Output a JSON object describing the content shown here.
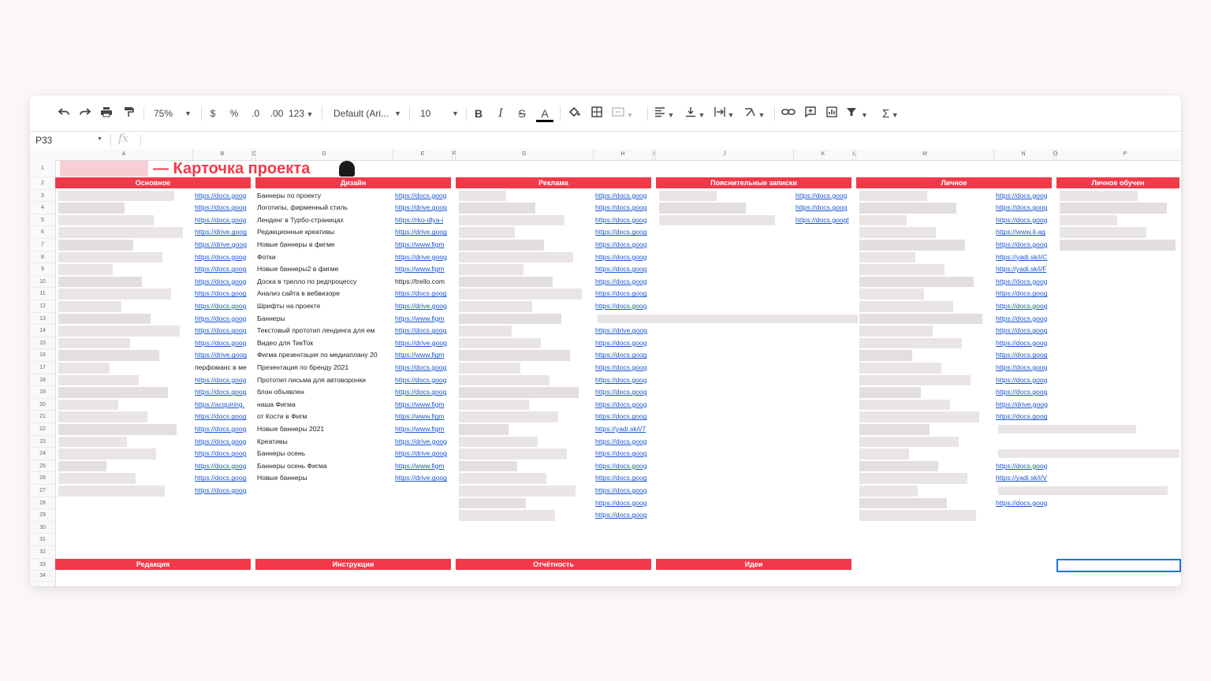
{
  "toolbar": {
    "zoom": "75%",
    "currency": "$",
    "percent": "%",
    "dec_less": ".0",
    "dec_more": ".00",
    "more_formats": "123",
    "font": "Default (Ari...",
    "font_size": "10",
    "bold": "B",
    "italic": "I",
    "strike": "S",
    "text_color": "A",
    "sum": "Σ"
  },
  "formula_bar": {
    "cell_ref": "P33",
    "fx": "fx",
    "value": ""
  },
  "columns": [
    {
      "letter": "A",
      "w": 175
    },
    {
      "letter": "B",
      "w": 75
    },
    {
      "letter": "C",
      "w": 4
    },
    {
      "letter": "D",
      "w": 175
    },
    {
      "letter": "E",
      "w": 75
    },
    {
      "letter": "F",
      "w": 4
    },
    {
      "letter": "G",
      "w": 175
    },
    {
      "letter": "H",
      "w": 75
    },
    {
      "letter": "I",
      "w": 4
    },
    {
      "letter": "J",
      "w": 175
    },
    {
      "letter": "K",
      "w": 75
    },
    {
      "letter": "L",
      "w": 4
    },
    {
      "letter": "M",
      "w": 175
    },
    {
      "letter": "N",
      "w": 75
    },
    {
      "letter": "O",
      "w": 4
    },
    {
      "letter": "P",
      "w": 175
    }
  ],
  "rows": [
    "1",
    "2",
    "3",
    "4",
    "5",
    "6",
    "7",
    "8",
    "9",
    "10",
    "11",
    "12",
    "13",
    "14",
    "15",
    "16",
    "17",
    "18",
    "19",
    "20",
    "21",
    "22",
    "23",
    "24",
    "25",
    "26",
    "27",
    "28",
    "29",
    "30",
    "31",
    "32",
    "33",
    "34"
  ],
  "title": {
    "text": "— Карточка проекта",
    "accent": "#f2394a"
  },
  "sections_top": [
    "Основное",
    "Дизайн",
    "Реклама",
    "Пояснительные записки",
    "Личное",
    "Личное обучен"
  ],
  "sections_bottom": [
    "Редакция",
    "Инструкции",
    "Отчётность",
    "Идеи"
  ],
  "col_b_links": [
    "https://docs.goog",
    "https://docs.goog",
    "https://docs.goog",
    "https://drive.goog",
    "https://drive.goog",
    "https://docs.goog",
    "https://docs.goog",
    "https://docs.goog",
    "https://docs.goog",
    "https://docs.goog",
    "https://docs.goog",
    "https://docs.goog",
    "https://docs.goog",
    "https://drive.goog",
    "перфоманс в ме",
    "https://docs.goog",
    "https://docs.goog",
    "https://acquiring.",
    "https://docs.goog",
    "https://docs.goog",
    "https://docs.goog",
    "https://docs.goog",
    "https://docs.goog",
    "https://docs.goog",
    "https://docs.goog"
  ],
  "col_d_items": [
    "Баннеры по проекту",
    "Логотипы, фирменный стиль",
    "Лендинг в Турбо-страницах",
    "Редакционные креативы",
    "Новые баннеры в фигме",
    "Фотки",
    "Новые баннеры2 в фигме",
    "Доска в трелло по редпроцессу",
    "Анализ сайта в вебвизоре",
    "Шрифты на проекте",
    "Баннеры",
    "Текстовый прототип лендинга для ем",
    "Видео для ТикТок",
    "Фигма презентация по медиаплану 20",
    "Презентация по бренду 2021",
    "Прототип письма для автоворонки",
    "блон объявлен",
    "наша Фигма",
    "от Кости в Фигм",
    "Новые баннеры 2021",
    "Креативы",
    "Баннеры осень",
    "Баннеры осень Фигма",
    "Новые баннеры"
  ],
  "col_e_links": [
    "https://docs.goog",
    "https://drive.goog",
    "https://rko-dlya-i",
    "https://drive.goog",
    "https://www.figm",
    "https://drive.goog",
    "https://www.figm",
    "https://trello.com",
    "https://docs.goog",
    "https://drive.goog",
    "https://www.figm",
    "https://docs.goog",
    "https://drive.goog",
    "https://www.figm",
    "https://docs.goog",
    "https://docs.goog",
    "https://docs.goog",
    "https://www.figm",
    "https://www.figm",
    "https://www.figm",
    "https://drive.goog",
    "https://drive.goog",
    "https://www.figm",
    "https://drive.goog"
  ],
  "col_h_links": [
    "https://docs.goog",
    "https://docs.goog",
    "https://docs.goog",
    "https://docs.goog",
    "https://docs.goog",
    "https://docs.goog",
    "https://docs.goog",
    "https://docs.goog",
    "https://docs.goog",
    "https://docs.goog",
    "",
    "https://drive.goog",
    "https://docs.goog",
    "https://docs.goog",
    "https://docs.goog",
    "https://docs.goog",
    "https://docs.goog",
    "https://docs.goog",
    "https://docs.goog",
    "https://yadi.sk/i/7",
    "https://docs.goog",
    "https://docs.goog",
    "https://docs.goog",
    "https://docs.goog",
    "https://docs.goog",
    "https://docs.goog",
    "https://docs.goog"
  ],
  "col_k_links": [
    "https://docs.goog",
    "https://docs.goog",
    "https://docs.googl"
  ],
  "col_n_links": [
    "https://docs.goog",
    "https://docs.goog",
    "https://docs.goog",
    "https://www.it-ag",
    "https://docs.goog",
    "https://yadi.sk/i/C",
    "https://yadi.sk/i/F",
    "https://docs.goog",
    "https://docs.goog",
    "https://docs.goog",
    "https://docs.goog",
    "https://docs.goog",
    "https://docs.goog",
    "https://docs.goog",
    "https://docs.goog",
    "https://docs.goog",
    "https://docs.goog",
    "https://drive.goog",
    "https://docs.goog",
    "",
    "",
    "",
    "https://docs.goog",
    "https://yadi.sk/i/V",
    "",
    "https://docs.goog"
  ],
  "colors": {
    "section": "#f2394a",
    "link": "#1a55d4",
    "selection": "#1a73e8"
  }
}
